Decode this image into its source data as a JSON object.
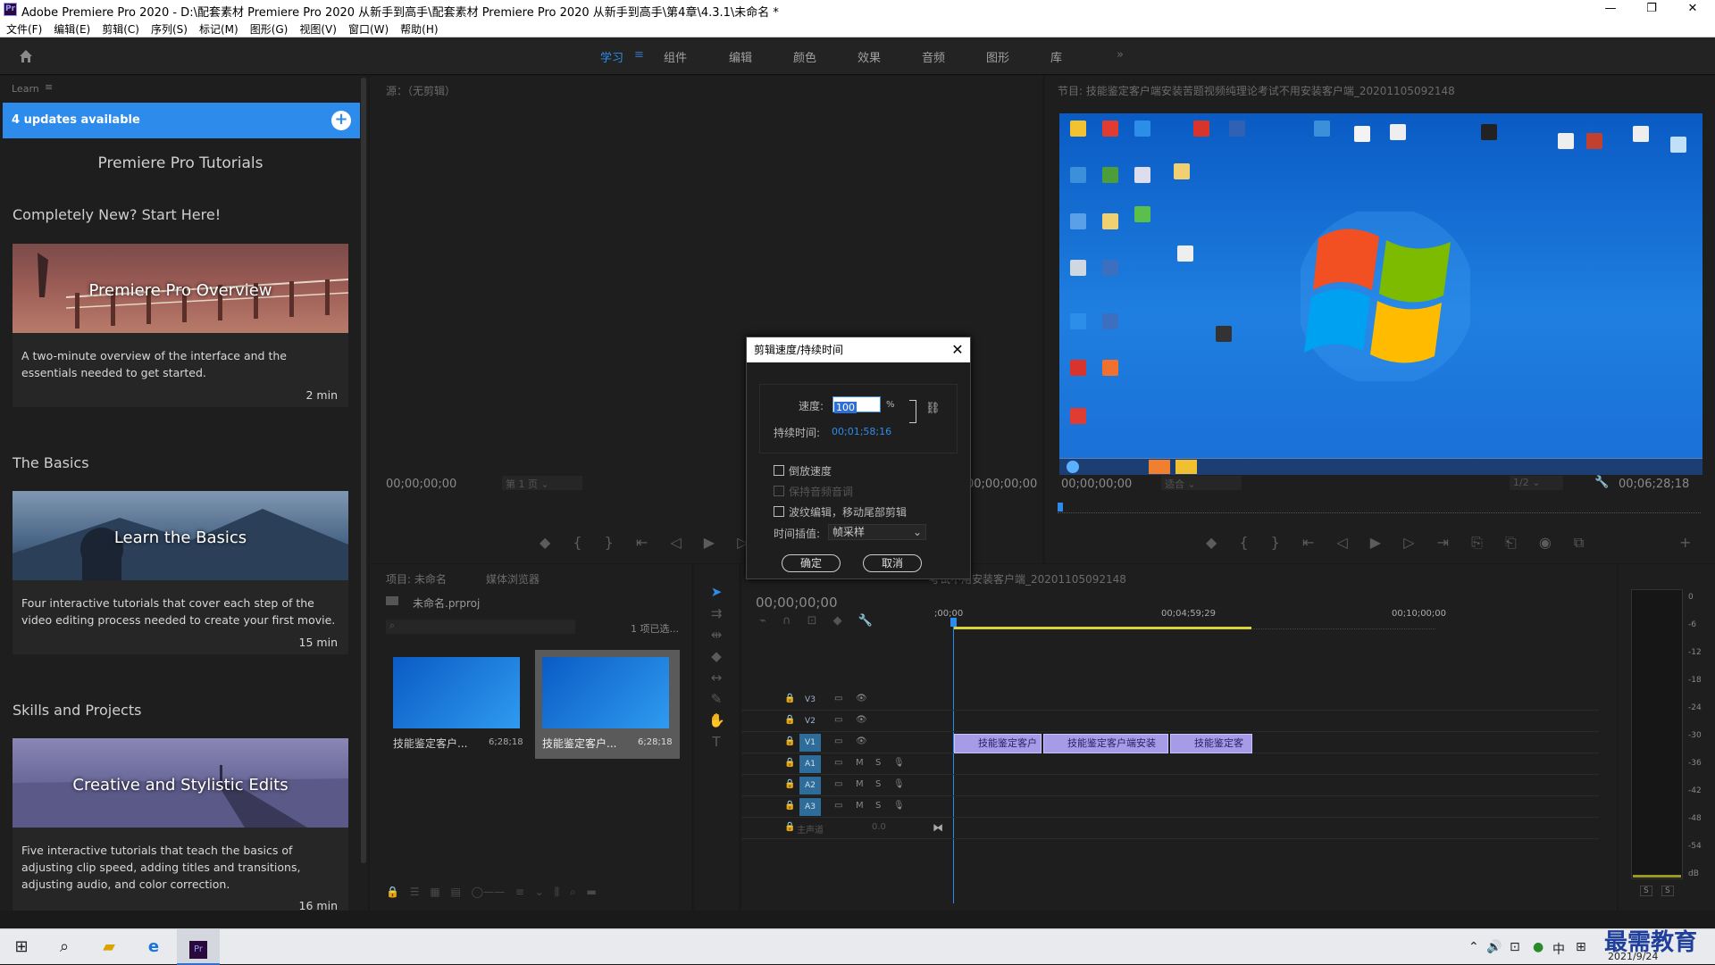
{
  "window": {
    "title": "Adobe Premiere Pro 2020 - D:\\配套素材 Premiere Pro 2020 从新手到高手\\配套素材 Premiere Pro 2020 从新手到高手\\第4章\\4.3.1\\未命名 *"
  },
  "menu": [
    "文件(F)",
    "编辑(E)",
    "剪辑(C)",
    "序列(S)",
    "标记(M)",
    "图形(G)",
    "视图(V)",
    "窗口(W)",
    "帮助(H)"
  ],
  "workspaces": [
    "学习",
    "组件",
    "编辑",
    "颜色",
    "效果",
    "音频",
    "图形",
    "库"
  ],
  "workspace_active": "学习",
  "learn": {
    "tab": "Learn",
    "updates": "4 updates available",
    "heading": "Premiere Pro Tutorials",
    "sections": [
      {
        "title": "Completely New? Start Here!"
      },
      {
        "title": "The Basics"
      },
      {
        "title": "Skills and Projects"
      }
    ],
    "cards": [
      {
        "title": "Premiere Pro Overview",
        "desc": "A two-minute overview of the interface and the essentials needed to get started.",
        "dur": "2 min"
      },
      {
        "title": "Learn the Basics",
        "desc": "Four interactive tutorials that cover each step of the video editing process needed to create your first movie.",
        "dur": "15 min"
      },
      {
        "title": "Creative and Stylistic Edits",
        "desc": "Five interactive tutorials that teach the basics of adjusting clip speed, adding titles and transitions, adjusting audio, and color correction.",
        "dur": "16 min"
      }
    ]
  },
  "source": {
    "title": "源：（无剪辑）",
    "timecode_left": "00;00;00;00",
    "page": "第 1 页",
    "timecode_right": "00;00;00;00"
  },
  "program": {
    "title": "节目: 技能鉴定客户端安装苦题视频纯理论考试不用安装客户端_20201105092148",
    "timecode_left": "00;00;00;00",
    "fit": "适合",
    "ratio": "1/2",
    "timecode_right": "00;06;28;18"
  },
  "project": {
    "tabs": [
      "项目: 未命名",
      "媒体浏览器"
    ],
    "file": "未命名.prproj",
    "selected": "1 项已选...",
    "items": [
      {
        "name": "技能鉴定客户...",
        "dur": "6;28;18"
      },
      {
        "name": "技能鉴定客户...",
        "dur": "6;28;18"
      }
    ]
  },
  "timeline": {
    "title": "考试不用安装客户端_20201105092148",
    "timecode": "00;00;00;00",
    "ruler": [
      ";00;00",
      "00;04;59;29",
      "00;10;00;00"
    ],
    "tracks": [
      "V3",
      "V2",
      "V1",
      "A1",
      "A2",
      "A3"
    ],
    "master": "主声道",
    "master_val": "0.0",
    "clips": [
      "技能鉴定客户",
      "技能鉴定客户端安装",
      "技能鉴定客"
    ]
  },
  "meter": {
    "scale": [
      "0",
      "-6",
      "-12",
      "-18",
      "-24",
      "-30",
      "-36",
      "-42",
      "-48",
      "-54",
      "dB"
    ],
    "buttons": [
      "S",
      "S"
    ]
  },
  "dialog": {
    "title": "剪辑速度/持续时间",
    "speed_label": "速度:",
    "speed_value": "100",
    "speed_unit": "%",
    "duration_label": "持续时间:",
    "duration_value": "00;01;58;16",
    "opt_reverse": "倒放速度",
    "opt_pitch": "保持音频音调",
    "opt_ripple": "波纹编辑，移动尾部剪辑",
    "interp_label": "时间插值:",
    "interp_value": "帧采样",
    "ok": "确定",
    "cancel": "取消"
  },
  "taskbar": {
    "ime": "中",
    "date": "2021/9/24",
    "watermark": "最需教育"
  }
}
